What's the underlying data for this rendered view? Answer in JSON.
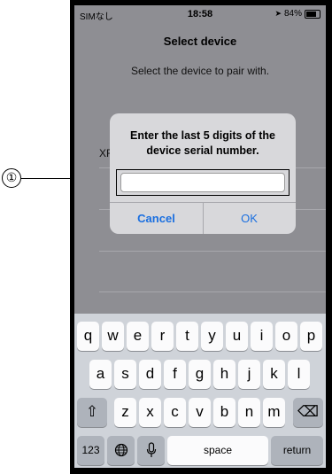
{
  "annotation": {
    "callout_label": "①"
  },
  "status_bar": {
    "carrier": "SIMなし",
    "time": "18:58",
    "location_icon": "➤",
    "battery": "84%"
  },
  "page": {
    "title": "Select device",
    "subtitle": "Select the device to pair with.",
    "device_row_label": "XF"
  },
  "alert": {
    "title_line1": "Enter the last 5 digits of the",
    "title_line2": "device serial number.",
    "input_value": "",
    "cancel_label": "Cancel",
    "ok_label": "OK"
  },
  "keyboard": {
    "row1": [
      "q",
      "w",
      "e",
      "r",
      "t",
      "y",
      "u",
      "i",
      "o",
      "p"
    ],
    "row2": [
      "a",
      "s",
      "d",
      "f",
      "g",
      "h",
      "j",
      "k",
      "l"
    ],
    "row3": [
      "z",
      "x",
      "c",
      "v",
      "b",
      "n",
      "m"
    ],
    "shift_icon": "⇧",
    "delete_icon": "⌫",
    "numbers_label": "123",
    "globe_icon": "🌐",
    "mic_icon": "mic",
    "space_label": "space",
    "return_label": "return"
  }
}
